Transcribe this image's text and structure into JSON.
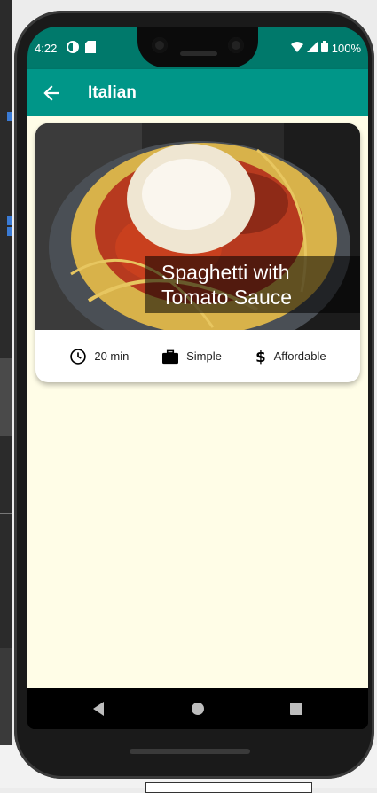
{
  "status_bar": {
    "time": "4:22",
    "battery": "100%"
  },
  "app_bar": {
    "title": "Italian"
  },
  "meal": {
    "title": "Spaghetti with Tomato Sauce",
    "duration": "20 min",
    "complexity": "Simple",
    "affordability": "Affordable"
  },
  "colors": {
    "primary": "#009688",
    "primary_dark": "#00796b",
    "background": "#fffde7"
  },
  "icons": {
    "back": "arrow-back-icon",
    "duration": "clock-icon",
    "complexity": "briefcase-icon",
    "affordability": "dollar-icon"
  }
}
